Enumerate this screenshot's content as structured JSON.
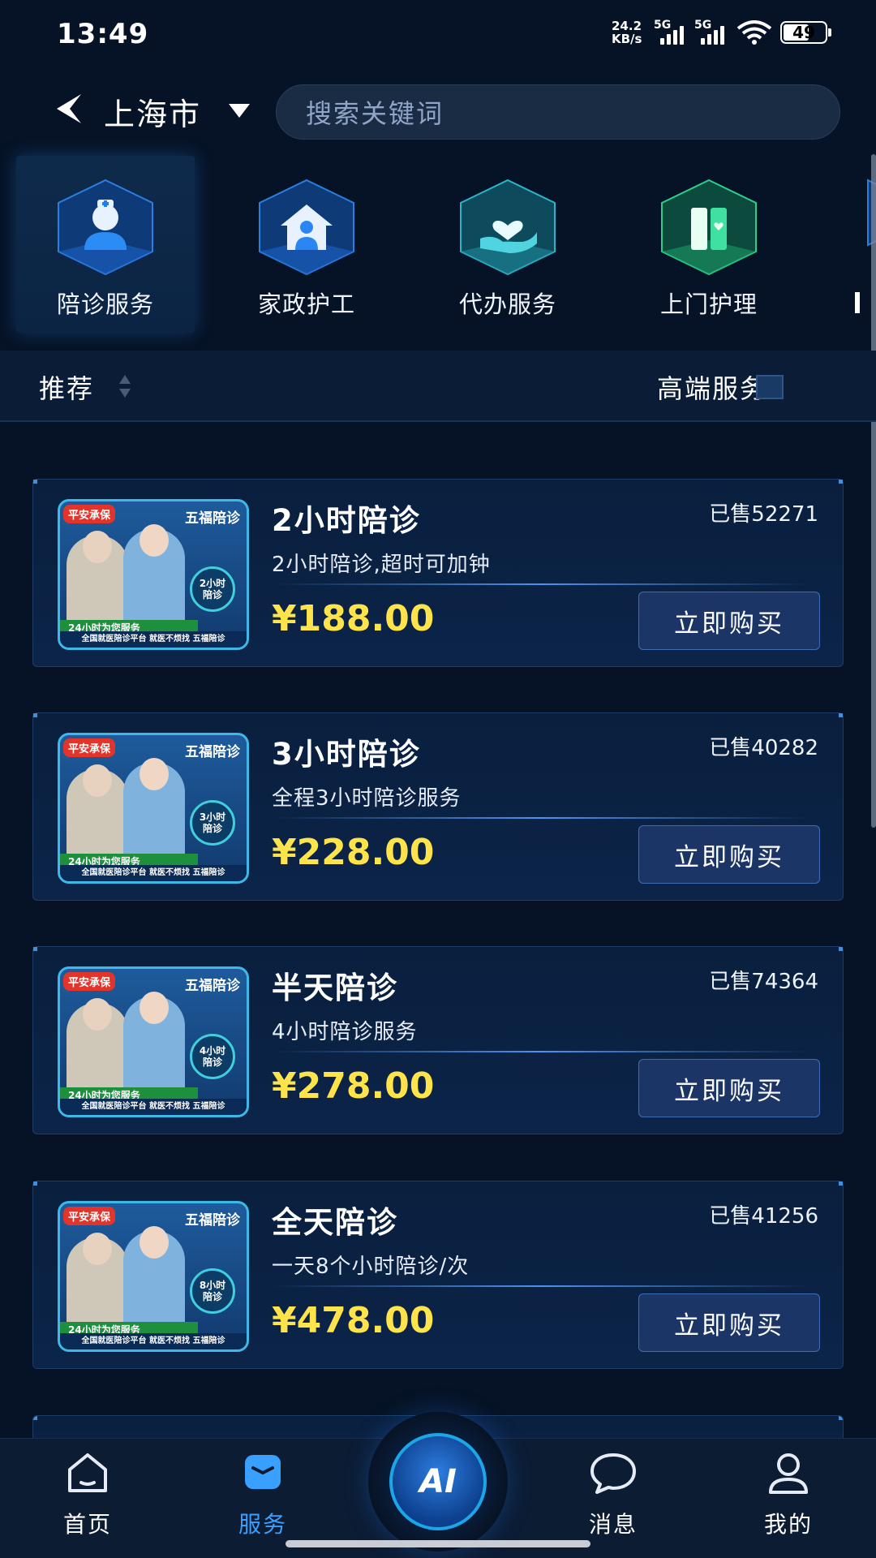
{
  "status_bar": {
    "time": "13:49",
    "net_speed_top": "24.2",
    "net_speed_bottom": "KB/s",
    "sim1": "5G",
    "sim2": "5G",
    "wifi_sub": "6",
    "battery": "49"
  },
  "header": {
    "city": "上海市",
    "search_placeholder": "搜索关键词"
  },
  "categories": [
    {
      "label": "陪诊服务",
      "icon": "nurse-icon",
      "color": "#1c7ef0"
    },
    {
      "label": "家政护工",
      "icon": "house-person-icon",
      "color": "#2b86f2"
    },
    {
      "label": "代办服务",
      "icon": "hand-heart-icon",
      "color": "#2bb5c9"
    },
    {
      "label": "上门护理",
      "icon": "door-heart-icon",
      "color": "#2ccf8a"
    }
  ],
  "filter": {
    "sort_label": "推荐",
    "premium_label": "高端服务"
  },
  "thumb_common": {
    "tag": "平安承保",
    "brand": "五福陪诊",
    "band": "24小时为您服务",
    "foot": "全国就医陪诊平台  就医不烦找  五福陪诊"
  },
  "products": [
    {
      "title": "2小时陪诊",
      "sold": "已售52271",
      "desc": "2小时陪诊,超时可加钟",
      "price": "¥188.00",
      "buy": "立即购买",
      "badge": "2小时陪诊"
    },
    {
      "title": "3小时陪诊",
      "sold": "已售40282",
      "desc": "全程3小时陪诊服务",
      "price": "¥228.00",
      "buy": "立即购买",
      "badge": "3小时陪诊"
    },
    {
      "title": "半天陪诊",
      "sold": "已售74364",
      "desc": "4小时陪诊服务",
      "price": "¥278.00",
      "buy": "立即购买",
      "badge": "4小时陪诊"
    },
    {
      "title": "全天陪诊",
      "sold": "已售41256",
      "desc": "一天8个小时陪诊/次",
      "price": "¥478.00",
      "buy": "立即购买",
      "badge": "8小时陪诊"
    }
  ],
  "tabbar": {
    "home": "首页",
    "service": "服务",
    "ai": "AI",
    "messages": "消息",
    "mine": "我的",
    "active_color": "#3aa0ff"
  }
}
